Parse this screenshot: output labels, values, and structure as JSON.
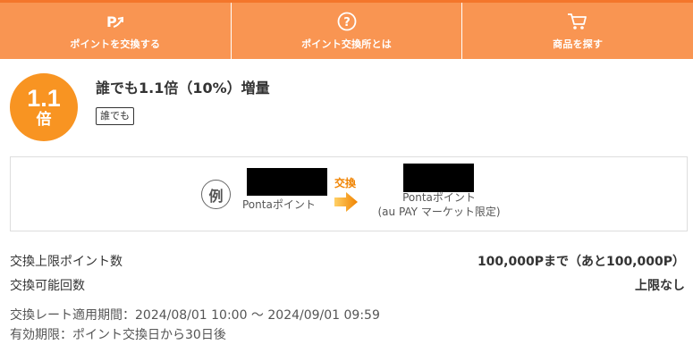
{
  "nav": {
    "items": [
      {
        "label": "ポイントを交換する",
        "icon": "point-exchange-icon"
      },
      {
        "label": "ポイント交換所とは",
        "icon": "question-circle-icon"
      },
      {
        "label": "商品を探す",
        "icon": "cart-icon"
      }
    ]
  },
  "offer": {
    "badge_number": "1.1",
    "badge_unit": "倍",
    "title": "誰でも1.1倍（10%）増量",
    "tag": "誰でも"
  },
  "example": {
    "mark": "例",
    "from_label": "Pontaポイント",
    "exchange_label": "交換",
    "to_label_line1": "Pontaポイント",
    "to_label_line2": "(au PAY マーケット限定)"
  },
  "details": {
    "limit_label": "交換上限ポイント数",
    "limit_value": "100,000Pまで（あと100,000P）",
    "count_label": "交換可能回数",
    "count_value": "上限なし",
    "rate_period": "交換レート適用期間：2024/08/01 10:00 〜 2024/09/01 09:59",
    "expiry": "有効期限：ポイント交換日から30日後"
  },
  "colors": {
    "nav_bg": "#f99552",
    "badge": "#f89422",
    "exchange_accent": "#f08300"
  }
}
